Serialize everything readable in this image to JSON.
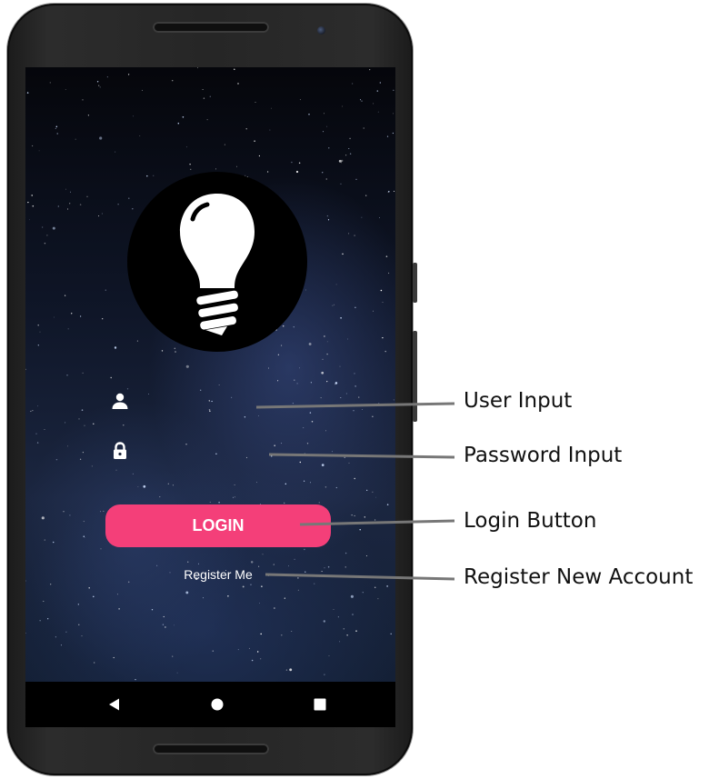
{
  "login_screen": {
    "login_button_label": "LOGIN",
    "register_link_label": "Register Me",
    "user_input": {
      "value": "",
      "placeholder": ""
    },
    "password_input": {
      "value": "",
      "placeholder": ""
    }
  },
  "icons": {
    "logo": "lightbulb-icon",
    "user_field": "person-icon",
    "password_field": "lock-icon",
    "nav_back": "back-triangle-icon",
    "nav_home": "home-circle-icon",
    "nav_recents": "recents-square-icon"
  },
  "colors": {
    "accent": "#f43f79",
    "screen_background": "#0f1628",
    "callout_line": "#777777"
  },
  "annotations": {
    "user_input": "User Input",
    "password_input": "Password Input",
    "login_button": "Login Button",
    "register_link": "Register New Account"
  }
}
